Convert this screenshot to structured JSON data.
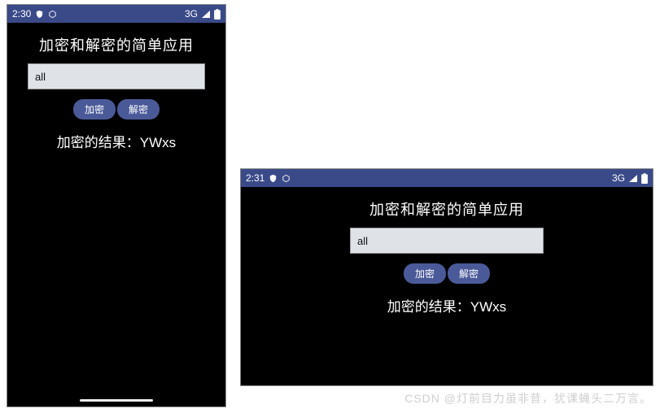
{
  "portrait": {
    "status": {
      "time": "2:30",
      "network": "3G"
    },
    "title": "加密和解密的简单应用",
    "input": "all",
    "btn_encrypt": "加密",
    "btn_decrypt": "解密",
    "result": "加密的结果：YWxs"
  },
  "landscape": {
    "status": {
      "time": "2:31",
      "network": "3G"
    },
    "title": "加密和解密的简单应用",
    "input": "all",
    "btn_encrypt": "加密",
    "btn_decrypt": "解密",
    "result": "加密的结果：YWxs"
  },
  "watermark": "CSDN @灯前目力虽非昔，犹课蝇头二万言。"
}
